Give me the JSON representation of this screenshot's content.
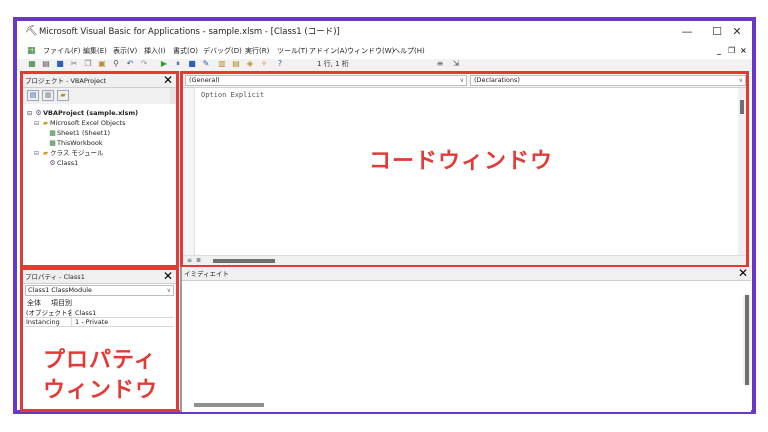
{
  "window": {
    "title": "Microsoft Visual Basic for Applications - sample.xlsm - [Class1 (コード)]",
    "minimize": "—",
    "maximize": "☐",
    "close": "✕"
  },
  "menubar": {
    "items": [
      "ファイル(F)",
      "編集(E)",
      "表示(V)",
      "挿入(I)",
      "書式(O)",
      "デバッグ(D)",
      "実行(R)",
      "ツール(T)",
      "アドイン(A)",
      "ウィンドウ(W)",
      "ヘルプ(H)"
    ],
    "mdi_minimize": "_",
    "mdi_restore": "❐",
    "mdi_close": "×"
  },
  "toolbar": {
    "position": "1 行, 1 桁"
  },
  "project_pane": {
    "title": "プロジェクト - VBAProject",
    "tree": [
      {
        "label": "VBAProject (sample.xlsm)",
        "level": 0,
        "icon": "project-icon",
        "expander": "⊟",
        "bold": true
      },
      {
        "label": "Microsoft Excel Objects",
        "level": 1,
        "icon": "folder-icon",
        "expander": "⊟",
        "bold": false
      },
      {
        "label": "Sheet1 (Sheet1)",
        "level": 2,
        "icon": "sheet-icon",
        "expander": "",
        "bold": false
      },
      {
        "label": "ThisWorkbook",
        "level": 2,
        "icon": "workbook-icon",
        "expander": "",
        "bold": false
      },
      {
        "label": "クラス モジュール",
        "level": 1,
        "icon": "folder-icon",
        "expander": "⊟",
        "bold": false
      },
      {
        "label": "Class1",
        "level": 2,
        "icon": "class-module-icon",
        "expander": "",
        "bold": false
      }
    ]
  },
  "code_pane": {
    "object_combo": "(General)",
    "procedure_combo": "(Declarations)",
    "code": "Option Explicit",
    "overlay_label": "コードウィンドウ"
  },
  "properties_pane": {
    "title": "プロパティ - Class1",
    "object_select": "Class1 ClassModule",
    "tabs": [
      "全体",
      "項目別"
    ],
    "rows": [
      {
        "name": "(オブジェクト名)",
        "value": "Class1"
      },
      {
        "name": "Instancing",
        "value": "1 - Private"
      }
    ],
    "overlay_label_line1": "プロパティ",
    "overlay_label_line2": "ウィンドウ"
  },
  "immediate_pane": {
    "title": "イミディエイト"
  },
  "colors": {
    "frame": "#6a38c9",
    "highlight": "#e53935"
  }
}
